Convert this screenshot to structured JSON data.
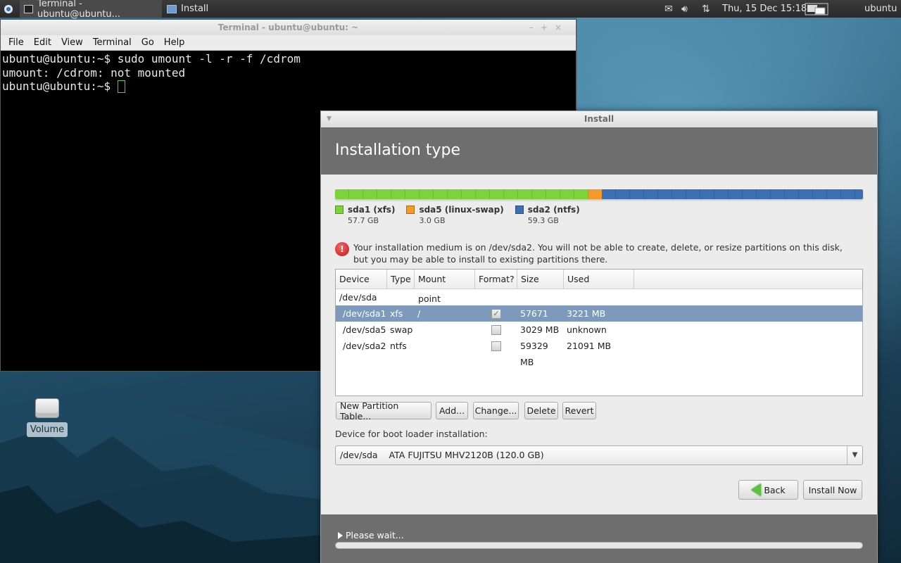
{
  "panel": {
    "tasks": [
      {
        "label": "Terminal - ubuntu@ubuntu..."
      },
      {
        "label": "Install"
      }
    ],
    "clock": "Thu, 15 Dec  15:18",
    "user": "ubuntu",
    "icons": [
      "xfce-menu-icon",
      "mail-icon",
      "volume-icon",
      "network-icon",
      "workspace-switcher-icon"
    ]
  },
  "terminal": {
    "title": "Terminal - ubuntu@ubuntu: ~",
    "menu": [
      "File",
      "Edit",
      "View",
      "Terminal",
      "Go",
      "Help"
    ],
    "lines": [
      "ubuntu@ubuntu:~$ sudo umount -l -r -f /cdrom",
      "umount: /cdrom: not mounted",
      "ubuntu@ubuntu:~$ "
    ]
  },
  "desktop": {
    "volume_label": "Volume"
  },
  "install": {
    "window_title": "Install",
    "heading": "Installation type",
    "partitions": [
      {
        "name": "sda1 (xfs)",
        "size": "57.7 GB",
        "color": "#7ed23a",
        "gb": 57.7
      },
      {
        "name": "sda5 (linux-swap)",
        "size": "3.0 GB",
        "color": "#f39a2b",
        "gb": 3.0
      },
      {
        "name": "sda2 (ntfs)",
        "size": "59.3 GB",
        "color": "#3e6fb2",
        "gb": 59.3
      }
    ],
    "warning": "Your installation medium is on /dev/sda2. You will not be able to create, delete, or resize partitions on this disk, but you may be able to install to existing partitions there.",
    "table": {
      "columns": [
        "Device",
        "Type",
        "Mount point",
        "Format?",
        "Size",
        "Used"
      ],
      "disk": "/dev/sda",
      "rows": [
        {
          "device": "/dev/sda1",
          "type": "xfs",
          "mount": "/",
          "format": true,
          "size": "57671 MB",
          "used": "3221 MB",
          "selected": true
        },
        {
          "device": "/dev/sda5",
          "type": "swap",
          "mount": "",
          "format": false,
          "size": "3029 MB",
          "used": "unknown",
          "selected": false
        },
        {
          "device": "/dev/sda2",
          "type": "ntfs",
          "mount": "",
          "format": false,
          "size": "59329 MB",
          "used": "21091 MB",
          "selected": false
        }
      ]
    },
    "buttons": {
      "new_table": "New Partition Table...",
      "add": "Add...",
      "change": "Change...",
      "delete": "Delete",
      "revert": "Revert",
      "back": "Back",
      "install_now": "Install Now"
    },
    "boot_label": "Device for boot loader installation:",
    "boot_device": "/dev/sda",
    "boot_description": "ATA FUJITSU MHV2120B (120.0 GB)",
    "status": "Please wait...",
    "progress": 0
  }
}
